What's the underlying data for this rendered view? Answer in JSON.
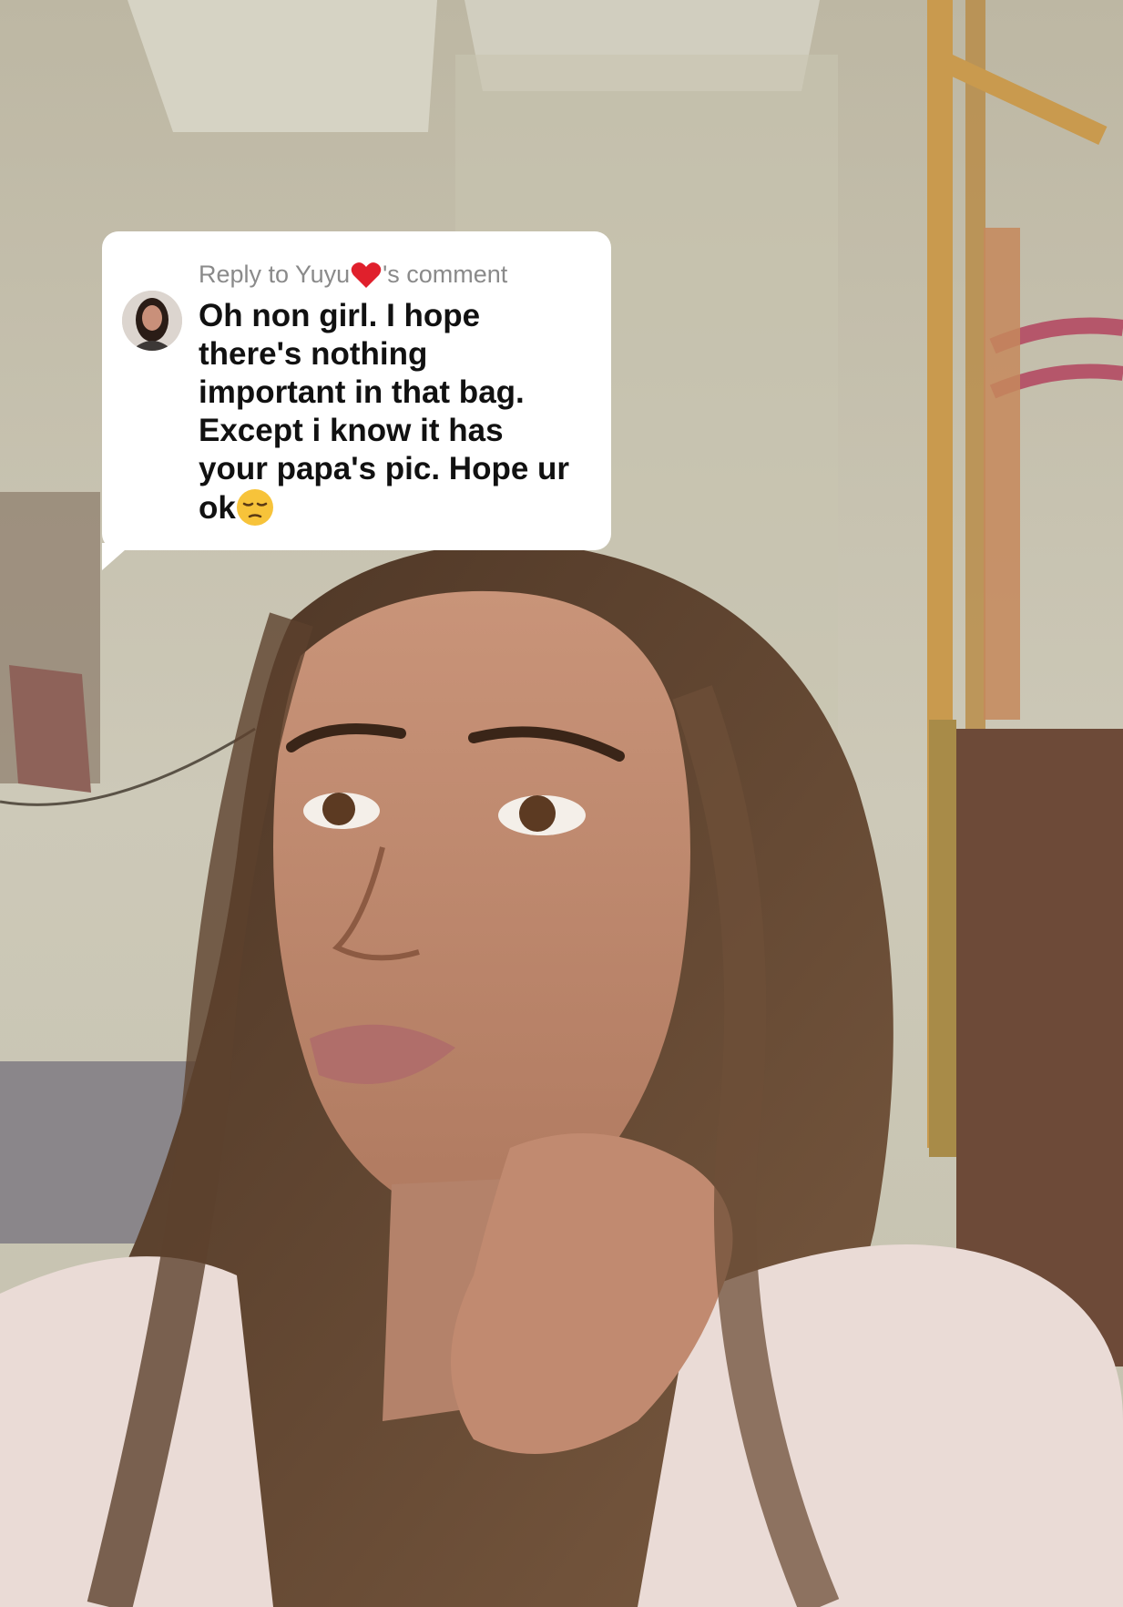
{
  "reply": {
    "header_prefix": "Reply to Yuyu",
    "header_suffix": "'s comment",
    "text_lines": [
      "Oh non girl. I hope",
      "there's nothing",
      "important in that bag.",
      "Except i know it has",
      "your papa's pic. Hope ur",
      "ok"
    ],
    "icons": {
      "heart": "red-heart-icon",
      "emoji": "pensive-face-emoji"
    }
  },
  "colors": {
    "card_bg": "#ffffff",
    "header_text": "#8a8a8a",
    "body_text": "#111111",
    "heart": "#e0202c",
    "emoji": "#f7c33a"
  }
}
